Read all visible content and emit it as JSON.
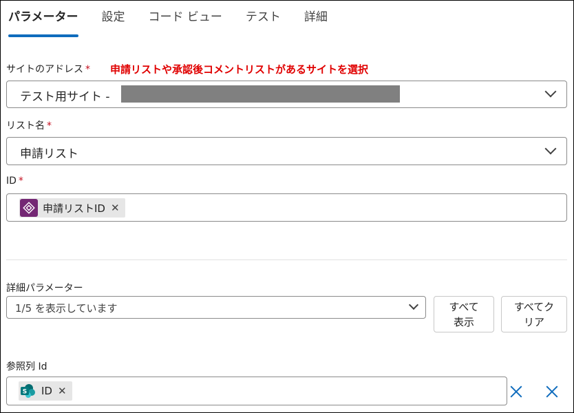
{
  "tabs": [
    {
      "label": "パラメーター",
      "active": true
    },
    {
      "label": "設定",
      "active": false
    },
    {
      "label": "コード ビュー",
      "active": false
    },
    {
      "label": "テスト",
      "active": false
    },
    {
      "label": "詳細",
      "active": false
    }
  ],
  "site": {
    "label": "サイトのアドレス",
    "required_mark": "*",
    "annotation": "申請リストや承認後コメントリストがあるサイトを選択",
    "value": "テスト用サイト -"
  },
  "list": {
    "label": "リスト名",
    "required_mark": "*",
    "value": "申請リスト"
  },
  "id_field": {
    "label": "ID",
    "required_mark": "*",
    "token_text": "申請リストID",
    "token_close": "✕",
    "token_icon": "power-automate-expression-icon",
    "token_color": "#742774"
  },
  "advanced": {
    "label": "詳細パラメーター",
    "select_value": "1/5 を表示しています",
    "show_all": [
      "すべて",
      "表示"
    ],
    "clear_all": [
      "すべてク",
      "リア"
    ]
  },
  "lookup": {
    "label": "参照列 Id",
    "token_text": "ID",
    "token_close": "✕",
    "token_icon": "sharepoint-icon",
    "token_color": "#038387"
  },
  "colors": {
    "accent": "#0f6cbd",
    "annotation": "#e00000",
    "required": "#c50f1f"
  }
}
